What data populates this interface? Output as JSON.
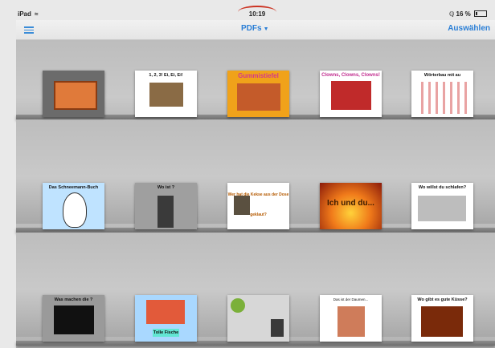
{
  "status_bar": {
    "device": "iPad",
    "time": "10:19",
    "battery": "16 %"
  },
  "nav_bar": {
    "title": "PDFs",
    "select_label": "Auswählen"
  },
  "books": [
    {
      "title": ""
    },
    {
      "title": "1, 2, 3! Ei, Ei, Ei!"
    },
    {
      "title": "Gummistiefel"
    },
    {
      "title": "Clowns, Clowns, Clowns!"
    },
    {
      "title": "Wörterbau mit au"
    },
    {
      "title": "Das Schneemann-Buch"
    },
    {
      "title": "Wo ist ?"
    },
    {
      "title": "Wer hat die Kekse aus der Dose geklaut?"
    },
    {
      "title": "Ich und du..."
    },
    {
      "title": "Wo willst du schlafen?"
    },
    {
      "title": "Was machen die ?"
    },
    {
      "title": "Tolle Fische"
    },
    {
      "title": ""
    },
    {
      "title": "Das ist der Daumen..."
    },
    {
      "title": "Wo gibt es gute Küsse?"
    }
  ]
}
